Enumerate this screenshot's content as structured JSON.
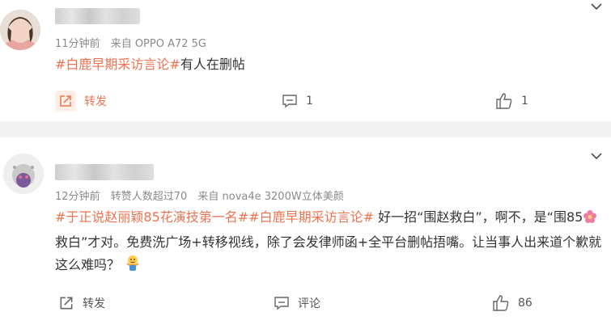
{
  "posts": [
    {
      "meta": {
        "time": "11分钟前",
        "source": "来自 OPPO A72 5G"
      },
      "content": {
        "tag": "#白鹿早期采访言论#",
        "text": "有人在删帖"
      },
      "actions": {
        "repost": "转发",
        "comments": "1",
        "likes": "1"
      }
    },
    {
      "meta": {
        "time": "12分钟前",
        "note": "转赞人数超过70",
        "source": "来自 nova4e 3200W立体美颜"
      },
      "content": {
        "tag1": "#于正说赵丽颖85花演技第一名#",
        "tag2": "#白鹿早期采访言论#",
        "text1": " 好一招“围赵救白”，啊不，是“围85",
        "text2": "救白”才对。免费洗广场+转移视线，除了会发律师函+全平台删帖捂嘴。让当事人出来道个歉就这么难吗？"
      },
      "actions": {
        "repost": "转发",
        "comment": "评论",
        "likes": "86"
      }
    }
  ],
  "icons": {
    "caret": "chevron-down-icon",
    "repost": "share-arrow-icon",
    "comment": "comment-bubble-icon",
    "like": "thumbs-up-icon",
    "flower": "pink-flower-emoji",
    "shrug": "shrug-emoji"
  },
  "colors": {
    "tag": "#eb7350",
    "meta": "#8a8a8a",
    "text": "#333333",
    "divider": "#f2f2f2"
  }
}
